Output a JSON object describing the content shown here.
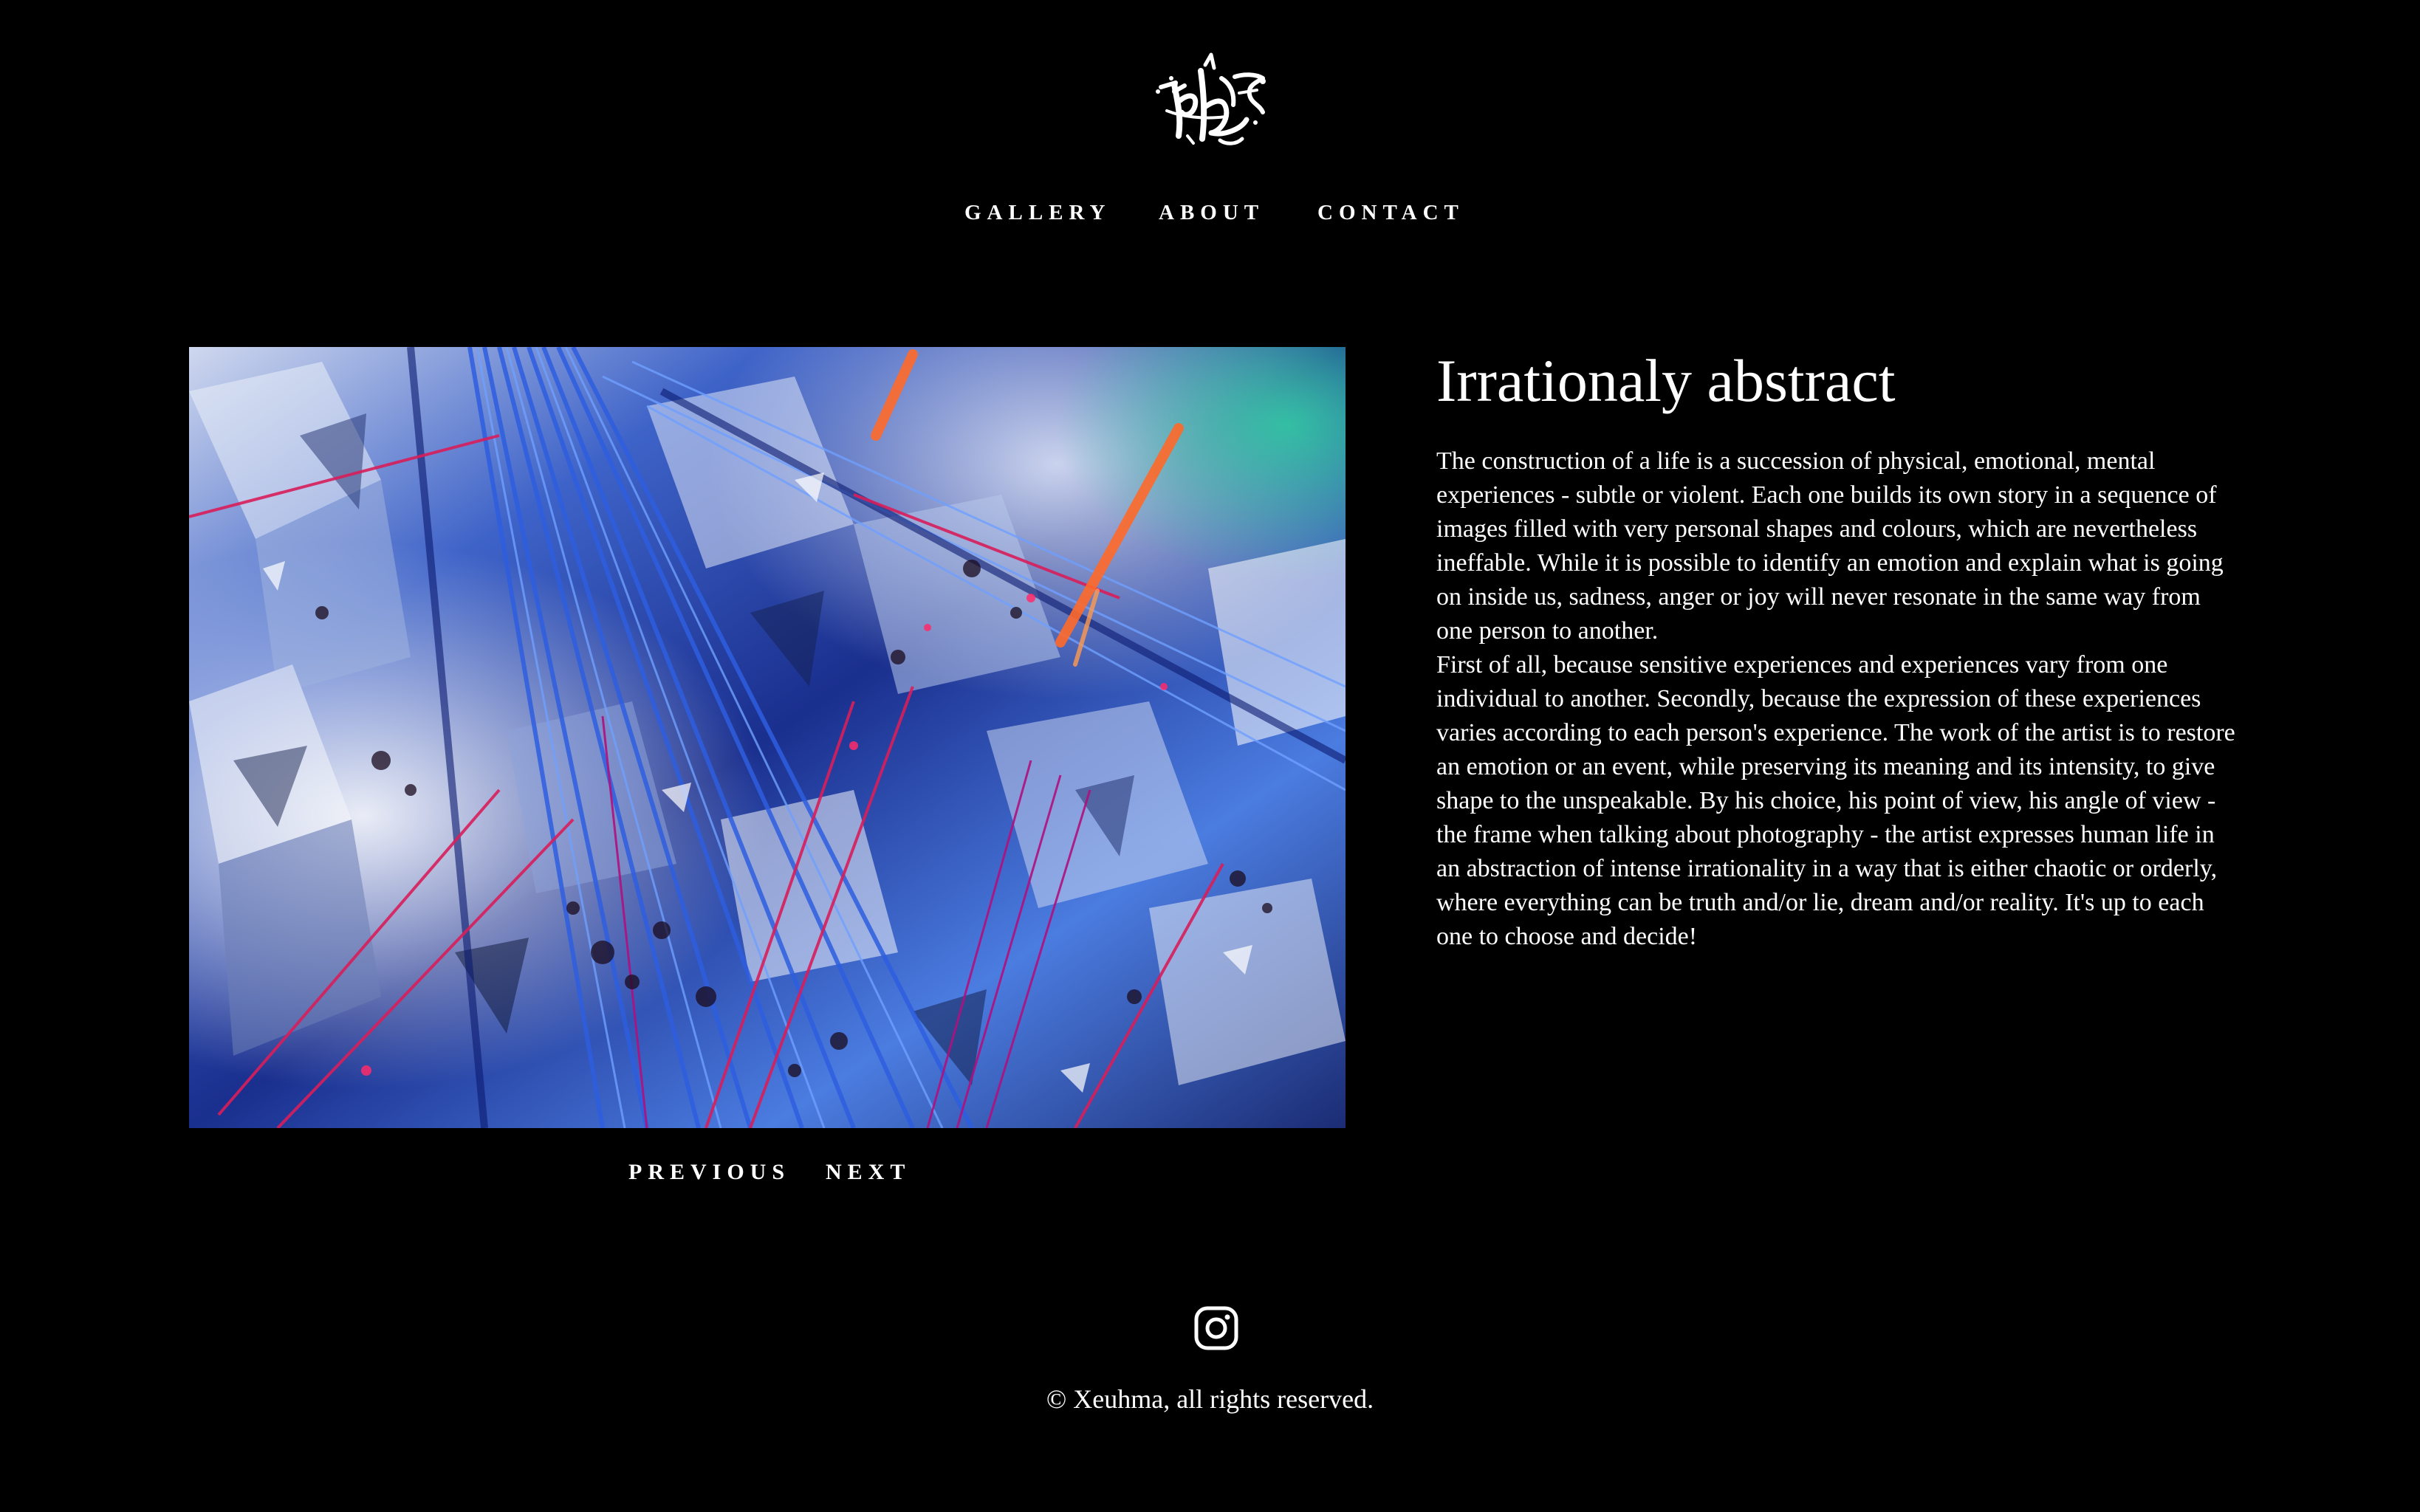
{
  "brand": {
    "logo_icon": "graffiti-signature-logo"
  },
  "nav": {
    "items": [
      {
        "label": "GALLERY"
      },
      {
        "label": "ABOUT"
      },
      {
        "label": "CONTACT"
      }
    ]
  },
  "artwork": {
    "description": "Abstract photograph of crumpled metallic foil with blue, pink, red and orange paint streaks",
    "palette": [
      "#1c3fb0",
      "#3a6ee8",
      "#c9d6f0",
      "#d81e5b",
      "#ff6a2a",
      "#7a1c7a",
      "#2bd4a0"
    ]
  },
  "pager": {
    "previous_label": "PREVIOUS",
    "next_label": "NEXT"
  },
  "content": {
    "title": "Irrationaly abstract",
    "paragraph_1": "The construction of a life is a succession of physical, emotional, mental experiences - subtle or violent. Each one builds its own story in a sequence of images filled with very personal shapes and colours, which are nevertheless ineffable. While it is possible to identify an emotion and explain what is going on inside us, sadness, anger or joy will never resonate in the same way from one person to another.",
    "paragraph_2": "First of all, because sensitive experiences and experiences vary from one individual to another. Secondly, because the expression of these experiences varies according to each person's experience. The work of the artist is to restore an emotion or an event, while preserving its meaning and its intensity, to give shape to the unspeakable. By his choice, his point of view, his angle of view - the frame when talking about photography - the artist expresses human life in an abstraction of intense irrationality in a way that is either chaotic or orderly, where everything can be truth and/or lie, dream and/or reality. It's up to each one to choose and decide!"
  },
  "footer": {
    "social_icon": "instagram-icon",
    "copyright": "© Xeuhma, all rights reserved."
  },
  "colors": {
    "background": "#000000",
    "text": "#ffffff"
  }
}
